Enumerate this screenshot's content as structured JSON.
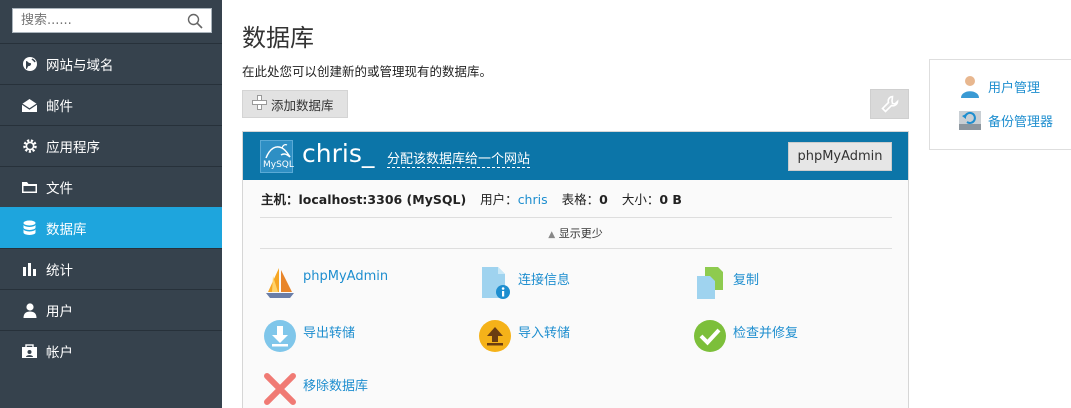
{
  "search": {
    "placeholder": "搜索......"
  },
  "sidebar": {
    "items": [
      {
        "label": "网站与域名",
        "icon": "globe-icon"
      },
      {
        "label": "邮件",
        "icon": "mail-icon"
      },
      {
        "label": "应用程序",
        "icon": "gear-icon"
      },
      {
        "label": "文件",
        "icon": "folder-icon"
      },
      {
        "label": "数据库",
        "icon": "database-icon",
        "active": true
      },
      {
        "label": "统计",
        "icon": "bar-chart-icon"
      },
      {
        "label": "用户",
        "icon": "user-icon"
      },
      {
        "label": "帐户",
        "icon": "account-icon"
      }
    ]
  },
  "page": {
    "title": "数据库",
    "description": "在此处您可以创建新的或管理现有的数据库。",
    "add_button": "添加数据库"
  },
  "database": {
    "logo_text": "MySQL",
    "name": "chris_",
    "assign_link": "分配该数据库给一个网站",
    "phpmyadmin_button": "phpMyAdmin",
    "host_label": "主机：",
    "host_value": "localhost:3306 (MySQL)",
    "user_label": "用户：",
    "user_value": "chris",
    "tables_label": "表格：",
    "tables_value": "0",
    "size_label": "大小：",
    "size_value": "0 B",
    "toggle_label": "显示更少"
  },
  "actions": {
    "phpmyadmin": "phpMyAdmin",
    "connection_info": "连接信息",
    "copy": "复制",
    "export_dump": "导出转储",
    "import_dump": "导入转储",
    "check_repair": "检查并修复",
    "remove_db": "移除数据库"
  },
  "right_panel": {
    "user_management": "用户管理",
    "backup_manager": "备份管理器"
  },
  "colors": {
    "sidebar_bg": "#36424d",
    "active_item": "#1ea5dd",
    "db_header": "#0c75a8",
    "link": "#1e8ecf"
  }
}
